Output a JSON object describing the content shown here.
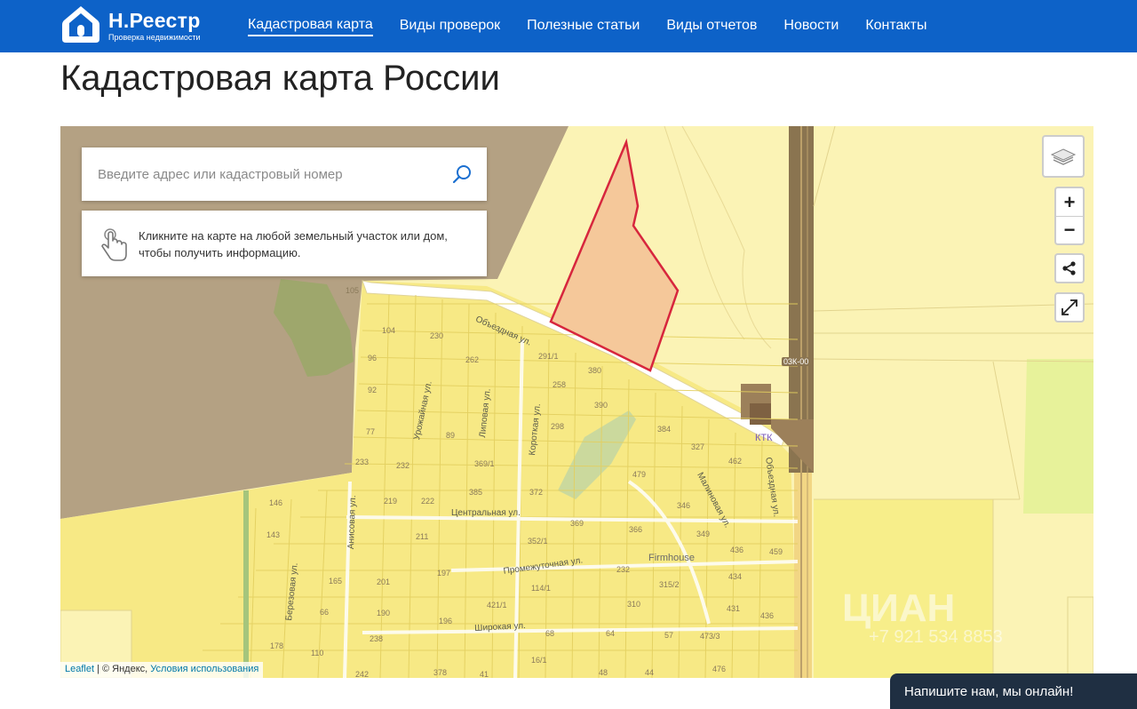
{
  "header": {
    "logo_title": "Н.Реестр",
    "logo_subtitle": "Проверка недвижимости",
    "nav": [
      {
        "label": "Кадастровая карта",
        "active": true
      },
      {
        "label": "Виды проверок",
        "active": false
      },
      {
        "label": "Полезные статьи",
        "active": false
      },
      {
        "label": "Виды отчетов",
        "active": false
      },
      {
        "label": "Новости",
        "active": false
      },
      {
        "label": "Контакты",
        "active": false
      }
    ],
    "color": "#0d62c8"
  },
  "page": {
    "title": "Кадастровая карта России"
  },
  "map": {
    "search_placeholder": "Введите адрес или кадастровый номер",
    "hint": "Кликните на карте на любой земельный участок или дом, чтобы получить информацию.",
    "controls": {
      "layers_icon": "layers-icon",
      "zoom_in": "+",
      "zoom_out": "−",
      "share_icon": "share-icon",
      "fullscreen_icon": "fullscreen-icon"
    },
    "attribution": {
      "leaflet": "Leaflet",
      "separator": " | © Яндекс, ",
      "terms": "Условия использования"
    },
    "streets": {
      "obezdnaya": "Объездная ул.",
      "urozhaynaya": "Урожайная ул.",
      "lipovaya": "Липовая ул.",
      "korotkaya": "Короткая ул.",
      "tsentralnaya": "Центральная ул.",
      "promezhutochnaya": "Промежуточная ул.",
      "shirokaya": "Широкая ул.",
      "berezovaya": "Березовая ул.",
      "aniskovaya": "Анисовая ул.",
      "malinovaya": "Малиновая ул.",
      "obezdnaya2": "Объездная ул."
    },
    "pois": {
      "ktk": "КТК",
      "firmhouse": "Firmhouse",
      "road": "03К-00"
    },
    "parcel_numbers": [
      "105",
      "104",
      "230",
      "96",
      "262",
      "291/1",
      "380",
      "92",
      "258",
      "390",
      "77",
      "89",
      "369/1",
      "298",
      "384",
      "327",
      "462",
      "233",
      "232",
      "385",
      "372",
      "479",
      "219",
      "222",
      "346",
      "349",
      "146",
      "143",
      "211",
      "352/1",
      "369",
      "366",
      "436",
      "459",
      "165",
      "197",
      "232",
      "201",
      "114/1",
      "315/2",
      "434",
      "66",
      "190",
      "421/1",
      "310",
      "431",
      "436",
      "196",
      "68",
      "178",
      "238",
      "64",
      "57",
      "473/3",
      "110",
      "16/1",
      "242",
      "378",
      "41",
      "48",
      "44",
      "476"
    ],
    "parcel_color": "#f5c89a",
    "parcel_border": "#d7263d",
    "watermark": "ЦИАН",
    "watermark_sub": "+7 921 534 8853"
  },
  "chat": {
    "label": "Напишите нам, мы онлайн!"
  }
}
